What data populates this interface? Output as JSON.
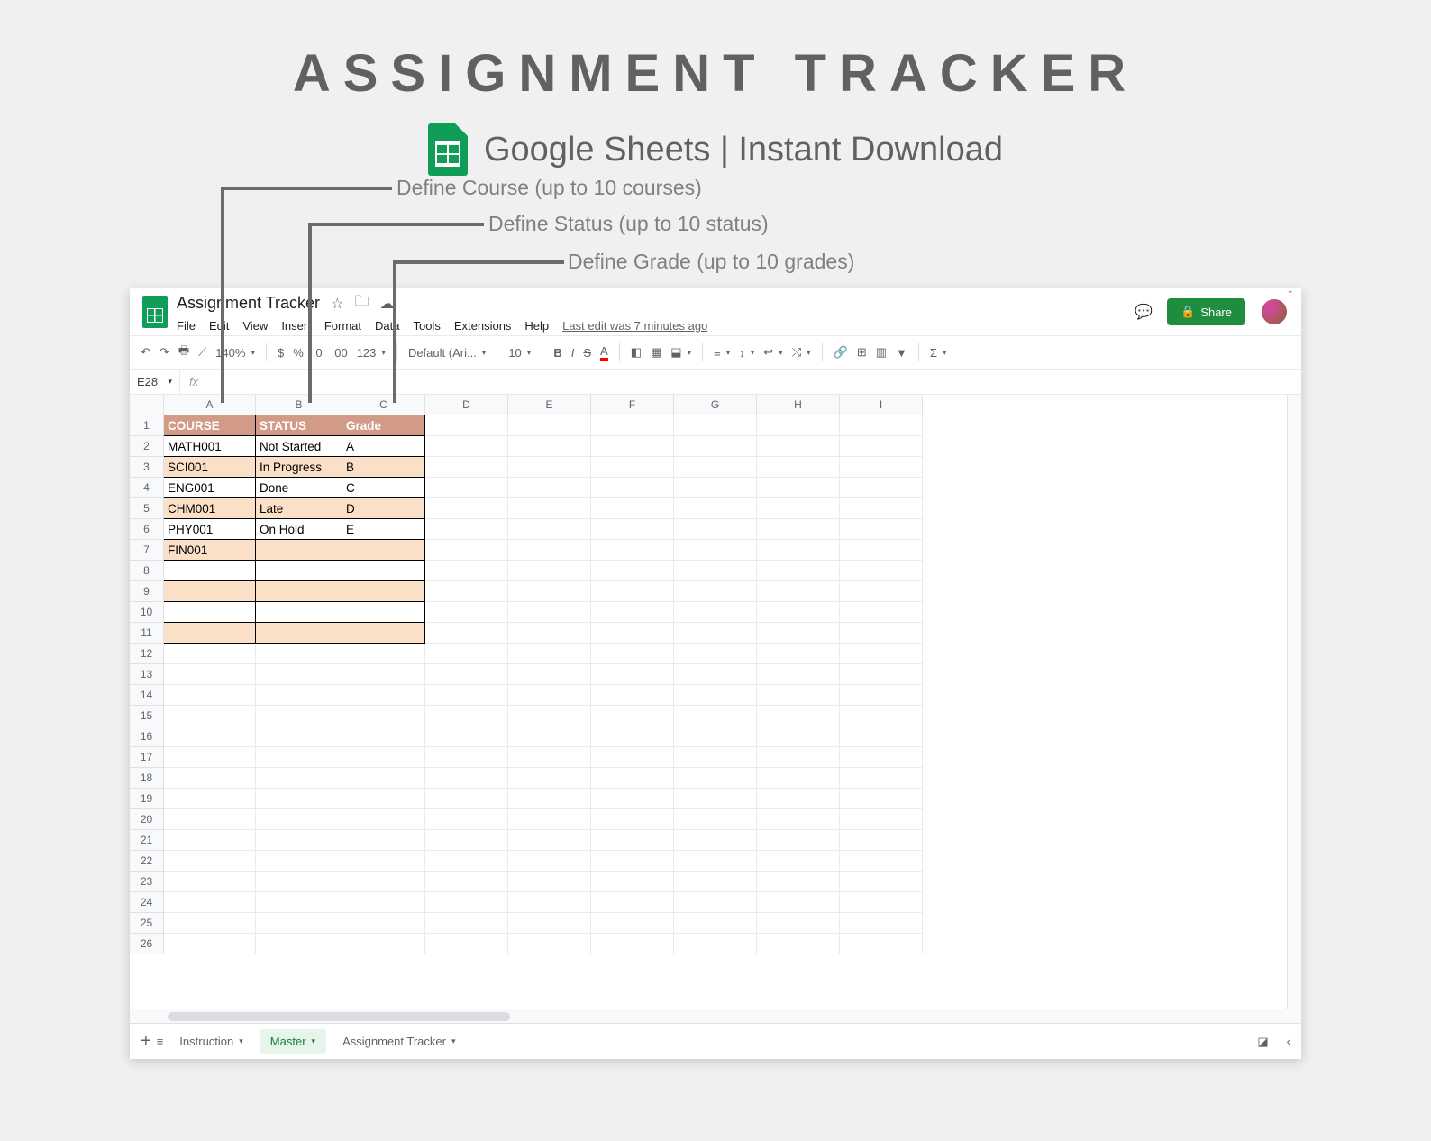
{
  "hero": {
    "title": "ASSIGNMENT TRACKER",
    "sub": "Google Sheets | Instant Download"
  },
  "callouts": {
    "course": "Define Course  (up to 10 courses)",
    "status": "Define Status  (up to 10 status)",
    "grade": "Define Grade (up to 10 grades)"
  },
  "doc": {
    "title": "Assignment Tracker",
    "last_edit": "Last edit was 7 minutes ago"
  },
  "menu": [
    "File",
    "Edit",
    "View",
    "Insert",
    "Format",
    "Data",
    "Tools",
    "Extensions",
    "Help"
  ],
  "toolbar": {
    "zoom": "140%",
    "font": "Default (Ari...",
    "size": "10"
  },
  "share": "Share",
  "namebox": "E28",
  "cols": [
    "A",
    "B",
    "C",
    "D",
    "E",
    "F",
    "G",
    "H",
    "I"
  ],
  "headers": {
    "c": "COURSE",
    "s": "STATUS",
    "g": "Grade"
  },
  "rows": [
    {
      "c": "MATH001",
      "s": "Not Started",
      "g": "A"
    },
    {
      "c": "SCI001",
      "s": "In Progress",
      "g": "B"
    },
    {
      "c": "ENG001",
      "s": "Done",
      "g": "C"
    },
    {
      "c": "CHM001",
      "s": "Late",
      "g": "D"
    },
    {
      "c": "PHY001",
      "s": "On Hold",
      "g": "E"
    },
    {
      "c": "FIN001",
      "s": "",
      "g": ""
    },
    {
      "c": "",
      "s": "",
      "g": ""
    },
    {
      "c": "",
      "s": "",
      "g": ""
    },
    {
      "c": "",
      "s": "",
      "g": ""
    },
    {
      "c": "",
      "s": "",
      "g": ""
    }
  ],
  "tabs": {
    "instruction": "Instruction",
    "master": "Master",
    "tracker": "Assignment Tracker"
  }
}
